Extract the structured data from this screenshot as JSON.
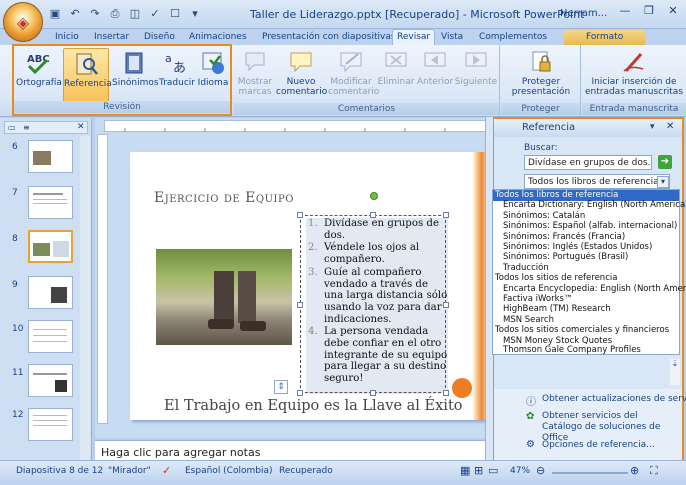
{
  "window": {
    "title": "Taller de Liderazgo.pptx [Recuperado] - Microsoft PowerPoint",
    "context_label": "Herram..."
  },
  "tabs": [
    {
      "label": "Inicio"
    },
    {
      "label": "Insertar"
    },
    {
      "label": "Diseño"
    },
    {
      "label": "Animaciones"
    },
    {
      "label": "Presentación con diapositivas"
    },
    {
      "label": "Revisar"
    },
    {
      "label": "Vista"
    },
    {
      "label": "Complementos"
    },
    {
      "label": "Formato"
    }
  ],
  "ribbon": {
    "revision": {
      "label": "Revisión",
      "buttons": [
        "Ortografía",
        "Referencia",
        "Sinónimos",
        "Traducir",
        "Idioma"
      ]
    },
    "comentarios": {
      "label": "Comentarios",
      "buttons": [
        "Mostrar marcas",
        "Nuevo comentario",
        "Modificar comentario",
        "Eliminar",
        "Anterior",
        "Siguiente"
      ]
    },
    "proteger": {
      "label": "Proteger",
      "buttons": [
        "Proteger presentación"
      ]
    },
    "entrada": {
      "label": "Entrada manuscrita",
      "buttons": [
        "Iniciar inserción de entradas manuscritas"
      ]
    }
  },
  "thumbnails": [
    "6",
    "7",
    "8",
    "9",
    "10",
    "11",
    "12"
  ],
  "slide": {
    "title": "Ejercicio de Equipo",
    "list": [
      {
        "num": "1.",
        "text": "Divídase en grupos de dos."
      },
      {
        "num": "2.",
        "text": "Véndele los ojos al compañero."
      },
      {
        "num": "3.",
        "text": "Guíe al compañero vendado a través de una larga distancia sólo usando la voz para dar indicaciones."
      },
      {
        "num": "4.",
        "text": "La persona vendada debe confiar en el otro integrante de su equipo para llegar a su destino seguro!"
      }
    ],
    "footer": "El Trabajo en Equipo es la Llave al Éxito"
  },
  "notes": {
    "placeholder": "Haga clic para agregar notas"
  },
  "research_pane": {
    "title": "Referencia",
    "search_label": "Buscar:",
    "search_value": "Divídase en grupos de dos. Vénc",
    "source_value": "Todos los libros de referencia",
    "dropdown": [
      {
        "text": "Todos los libros de referencia",
        "level": "sel"
      },
      {
        "text": "Encarta Dictionary: English (North America)",
        "level": "sub"
      },
      {
        "text": "Sinónimos: Catalán",
        "level": "sub"
      },
      {
        "text": "Sinónimos: Español (alfab. internacional)",
        "level": "sub"
      },
      {
        "text": "Sinónimos: Francés (Francia)",
        "level": "sub"
      },
      {
        "text": "Sinónimos: Inglés (Estados Unidos)",
        "level": "sub"
      },
      {
        "text": "Sinónimos: Portugués (Brasil)",
        "level": "sub"
      },
      {
        "text": "Traducción",
        "level": "sub"
      },
      {
        "text": "Todos los sitios de referencia",
        "level": "hdr"
      },
      {
        "text": "Encarta Encyclopedia: English (North America)",
        "level": "sub"
      },
      {
        "text": "Factiva iWorks™",
        "level": "sub"
      },
      {
        "text": "HighBeam (TM) Research",
        "level": "sub"
      },
      {
        "text": "MSN Search",
        "level": "sub"
      },
      {
        "text": "Todos los sitios comerciales y financieros",
        "level": "hdr"
      },
      {
        "text": "MSN Money Stock Quotes",
        "level": "sub"
      },
      {
        "text": "Thomson Gale Company Profiles",
        "level": "sub"
      }
    ],
    "update_link": "Obtener actualizaciones de servicio",
    "office_link": "Obtener servicios del Catálogo de soluciones de Office",
    "options_link": "Opciones de referencia..."
  },
  "statusbar": {
    "slide": "Diapositiva 8 de 12",
    "theme": "\"Mirador\"",
    "language": "Español (Colombia)",
    "state": "Recuperado",
    "zoom": "47%"
  },
  "colors": {
    "accent": "#e98b22",
    "ribbon_bg": "#dce8f7",
    "selection": "#3169c6"
  }
}
